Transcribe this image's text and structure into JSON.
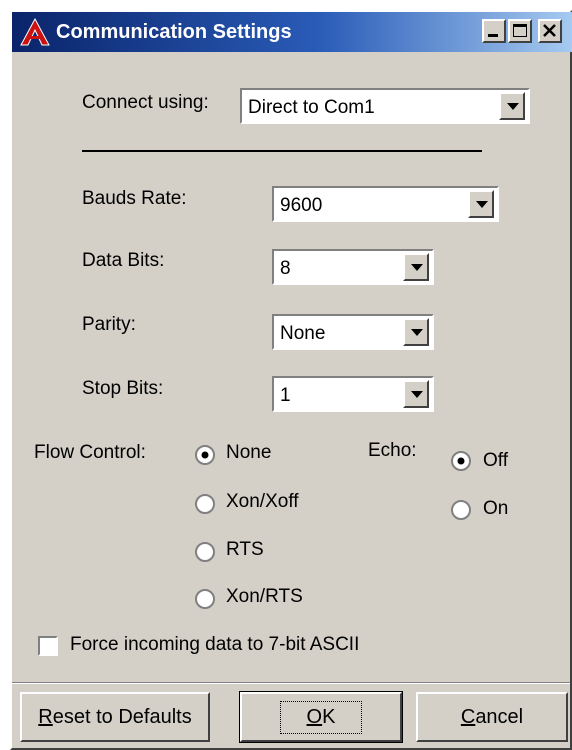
{
  "window": {
    "title": "Communication Settings",
    "caption_buttons": [
      "minimize",
      "maximize",
      "close"
    ]
  },
  "connect": {
    "label": "Connect using:",
    "value": "Direct to Com1"
  },
  "settings": {
    "baud": {
      "label": "Bauds Rate:",
      "value": "9600"
    },
    "data_bits": {
      "label": "Data Bits:",
      "value": "8"
    },
    "parity": {
      "label": "Parity:",
      "value": "None"
    },
    "stop_bits": {
      "label": "Stop Bits:",
      "value": "1"
    }
  },
  "flow_control": {
    "label": "Flow Control:",
    "selected": "None",
    "options": [
      "None",
      "Xon/Xoff",
      "RTS",
      "Xon/RTS"
    ]
  },
  "echo": {
    "label": "Echo:",
    "selected": "Off",
    "options": [
      "Off",
      "On"
    ]
  },
  "force_ascii": {
    "label": "Force incoming data to 7-bit ASCII",
    "checked": false
  },
  "buttons": {
    "reset": {
      "mnemonic": "R",
      "rest": "eset to Defaults"
    },
    "ok": {
      "mnemonic": "O",
      "rest": "K"
    },
    "cancel": {
      "mnemonic": "C",
      "rest": "ancel"
    }
  },
  "colors": {
    "face": "#d4d0c8",
    "title_start": "#0a246a",
    "title_end": "#a6caf0",
    "icon_red": "#cc1111"
  }
}
